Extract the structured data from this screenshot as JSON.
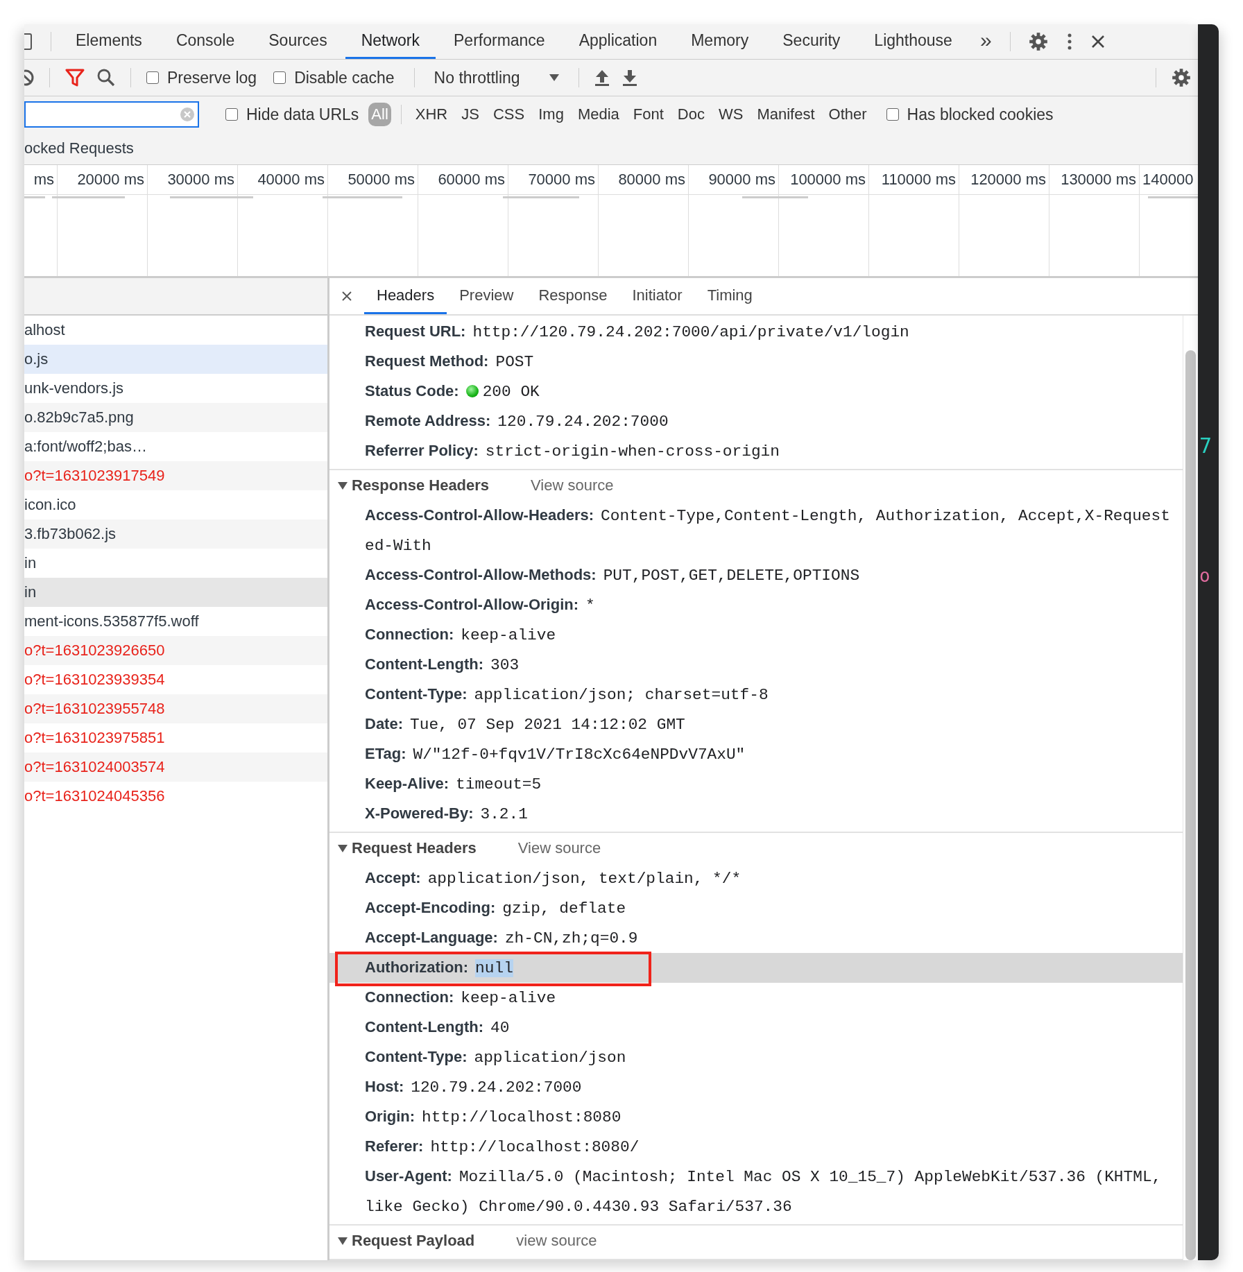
{
  "devtools_tabs": [
    {
      "label": "Elements",
      "selected": false
    },
    {
      "label": "Console",
      "selected": false
    },
    {
      "label": "Sources",
      "selected": false
    },
    {
      "label": "Network",
      "selected": true
    },
    {
      "label": "Performance",
      "selected": false
    },
    {
      "label": "Application",
      "selected": false
    },
    {
      "label": "Memory",
      "selected": false
    },
    {
      "label": "Security",
      "selected": false
    },
    {
      "label": "Lighthouse",
      "selected": false
    }
  ],
  "more_tabs": "»",
  "toolbar": {
    "filter_on": true,
    "preserve_log": {
      "label": "Preserve log",
      "checked": false
    },
    "disable_cache": {
      "label": "Disable cache",
      "checked": false
    },
    "throttling": "No throttling"
  },
  "filter_bar": {
    "hide_data_urls": {
      "label": "Hide data URLs",
      "checked": false
    },
    "types": [
      {
        "label": "All",
        "selected": true
      },
      {
        "label": "XHR",
        "selected": false
      },
      {
        "label": "JS",
        "selected": false
      },
      {
        "label": "CSS",
        "selected": false
      },
      {
        "label": "Img",
        "selected": false
      },
      {
        "label": "Media",
        "selected": false
      },
      {
        "label": "Font",
        "selected": false
      },
      {
        "label": "Doc",
        "selected": false
      },
      {
        "label": "WS",
        "selected": false
      },
      {
        "label": "Manifest",
        "selected": false
      },
      {
        "label": "Other",
        "selected": false
      }
    ],
    "has_blocked_cookies": {
      "label": "Has blocked cookies",
      "checked": false
    }
  },
  "blocked_requests": "ocked Requests",
  "timeline": {
    "ticks": [
      "ms",
      "20000 ms",
      "30000 ms",
      "40000 ms",
      "50000 ms",
      "60000 ms",
      "70000 ms",
      "80000 ms",
      "90000 ms",
      "100000 ms",
      "110000 ms",
      "120000 ms",
      "130000 ms",
      "140000"
    ]
  },
  "requests": [
    {
      "name": "alhost",
      "failed": false,
      "hovered": false,
      "selected": false
    },
    {
      "name": "o.js",
      "failed": false,
      "hovered": true,
      "selected": false
    },
    {
      "name": "unk-vendors.js",
      "failed": false,
      "hovered": false,
      "selected": false
    },
    {
      "name": "o.82b9c7a5.png",
      "failed": false,
      "hovered": false,
      "selected": false
    },
    {
      "name": "a:font/woff2;bas…",
      "failed": false,
      "hovered": false,
      "selected": false
    },
    {
      "name": "o?t=1631023917549",
      "failed": true,
      "hovered": false,
      "selected": false
    },
    {
      "name": "icon.ico",
      "failed": false,
      "hovered": false,
      "selected": false
    },
    {
      "name": "3.fb73b062.js",
      "failed": false,
      "hovered": false,
      "selected": false
    },
    {
      "name": "in",
      "failed": false,
      "hovered": false,
      "selected": false
    },
    {
      "name": "in",
      "failed": false,
      "hovered": false,
      "selected": true
    },
    {
      "name": "ment-icons.535877f5.woff",
      "failed": false,
      "hovered": false,
      "selected": false
    },
    {
      "name": "o?t=1631023926650",
      "failed": true,
      "hovered": false,
      "selected": false
    },
    {
      "name": "o?t=1631023939354",
      "failed": true,
      "hovered": false,
      "selected": false
    },
    {
      "name": "o?t=1631023955748",
      "failed": true,
      "hovered": false,
      "selected": false
    },
    {
      "name": "o?t=1631023975851",
      "failed": true,
      "hovered": false,
      "selected": false
    },
    {
      "name": "o?t=1631024003574",
      "failed": true,
      "hovered": false,
      "selected": false
    },
    {
      "name": "o?t=1631024045356",
      "failed": true,
      "hovered": false,
      "selected": false
    }
  ],
  "detail": {
    "tabs": [
      {
        "label": "Headers",
        "selected": true
      },
      {
        "label": "Preview",
        "selected": false
      },
      {
        "label": "Response",
        "selected": false
      },
      {
        "label": "Initiator",
        "selected": false
      },
      {
        "label": "Timing",
        "selected": false
      }
    ],
    "general": [
      {
        "kind": "text",
        "name": "Request URL:",
        "value": "http://120.79.24.202:7000/api/private/v1/login"
      },
      {
        "kind": "text",
        "name": "Request Method:",
        "value": "POST"
      },
      {
        "kind": "status",
        "name": "Status Code:",
        "value": "200 OK"
      },
      {
        "kind": "text",
        "name": "Remote Address:",
        "value": "120.79.24.202:7000"
      },
      {
        "kind": "text",
        "name": "Referrer Policy:",
        "value": "strict-origin-when-cross-origin"
      }
    ],
    "sections": [
      {
        "title": "Response Headers",
        "view_source": "View source",
        "expanded": true,
        "headers": [
          {
            "name": "Access-Control-Allow-Headers:",
            "value": "Content-Type,Content-Length, Authorization, Accept,X-Requested-With",
            "selected": false
          },
          {
            "name": "Access-Control-Allow-Methods:",
            "value": "PUT,POST,GET,DELETE,OPTIONS",
            "selected": false
          },
          {
            "name": "Access-Control-Allow-Origin:",
            "value": "*",
            "selected": false
          },
          {
            "name": "Connection:",
            "value": "keep-alive",
            "selected": false
          },
          {
            "name": "Content-Length:",
            "value": "303",
            "selected": false
          },
          {
            "name": "Content-Type:",
            "value": "application/json; charset=utf-8",
            "selected": false
          },
          {
            "name": "Date:",
            "value": "Tue, 07 Sep 2021 14:12:02 GMT",
            "selected": false
          },
          {
            "name": "ETag:",
            "value": "W/\"12f-0+fqv1V/TrI8cXc64eNPDvV7AxU\"",
            "selected": false
          },
          {
            "name": "Keep-Alive:",
            "value": "timeout=5",
            "selected": false
          },
          {
            "name": "X-Powered-By:",
            "value": "3.2.1",
            "selected": false
          }
        ]
      },
      {
        "title": "Request Headers",
        "view_source": "View source",
        "expanded": true,
        "headers": [
          {
            "name": "Accept:",
            "value": "application/json, text/plain, */*",
            "selected": false
          },
          {
            "name": "Accept-Encoding:",
            "value": "gzip, deflate",
            "selected": false
          },
          {
            "name": "Accept-Language:",
            "value": "zh-CN,zh;q=0.9",
            "selected": false
          },
          {
            "name": "Authorization:",
            "value": "null",
            "selected": true
          },
          {
            "name": "Connection:",
            "value": "keep-alive",
            "selected": false
          },
          {
            "name": "Content-Length:",
            "value": "40",
            "selected": false
          },
          {
            "name": "Content-Type:",
            "value": "application/json",
            "selected": false
          },
          {
            "name": "Host:",
            "value": "120.79.24.202:7000",
            "selected": false
          },
          {
            "name": "Origin:",
            "value": "http://localhost:8080",
            "selected": false
          },
          {
            "name": "Referer:",
            "value": "http://localhost:8080/",
            "selected": false
          },
          {
            "name": "User-Agent:",
            "value": "Mozilla/5.0 (Macintosh; Intel Mac OS X 10_15_7) AppleWebKit/537.36 (KHTML, like Gecko) Chrome/90.0.4430.93 Safari/537.36",
            "selected": false
          }
        ]
      },
      {
        "title": "Request Payload",
        "view_source": "view source",
        "expanded": true
      }
    ]
  },
  "editor_fragments": [
    {
      "text": "7",
      "color": "#2ad0c0"
    },
    {
      "text": "o",
      "color": "#e06c9f"
    }
  ]
}
